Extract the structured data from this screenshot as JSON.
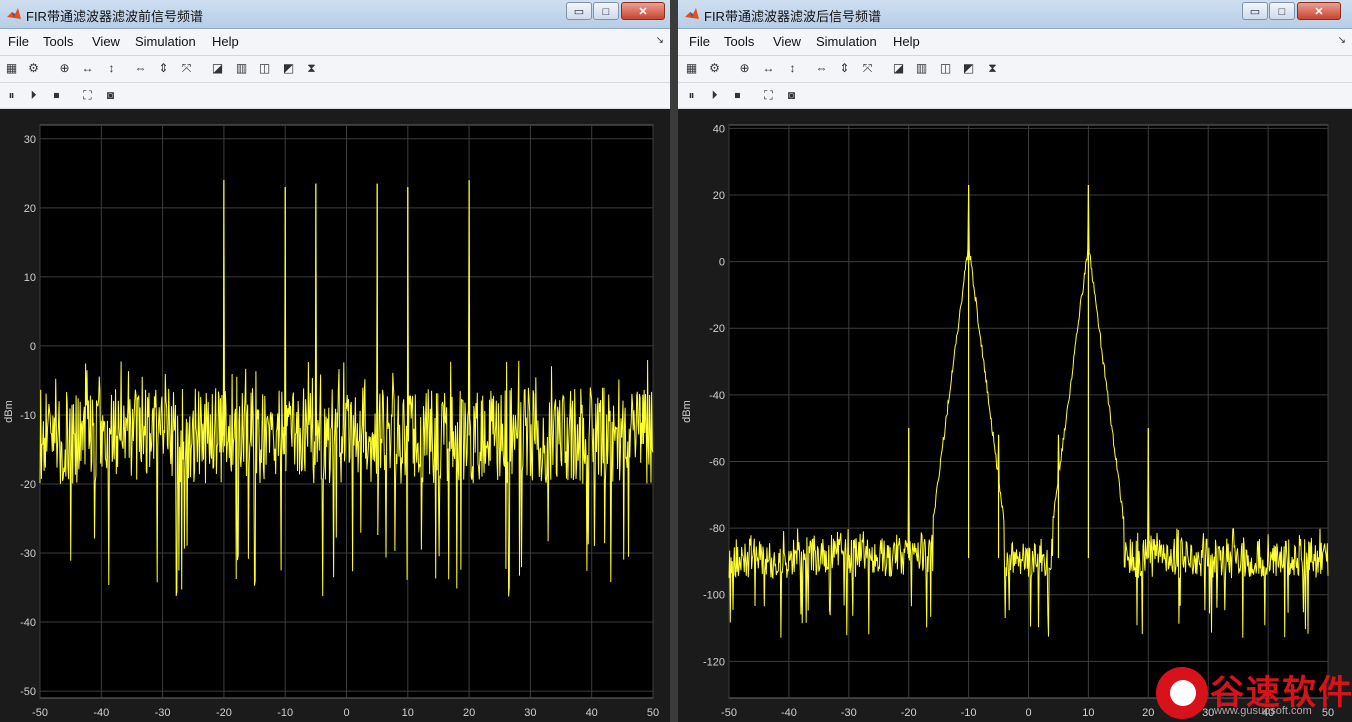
{
  "windows": [
    {
      "title": "FIR带通滤波器滤波前信号频谱",
      "menu": [
        "File",
        "Tools",
        "View",
        "Simulation",
        "Help"
      ],
      "window_buttons": {
        "minimize": "▭",
        "maximize": "□",
        "close": "✕"
      },
      "toolbar1_icons": [
        "new-scope-icon",
        "settings-gear-icon",
        "zoom-in-icon",
        "zoom-x-icon",
        "zoom-y-icon",
        "scale-x-icon",
        "scale-y-icon",
        "autoscale-icon",
        "triggers-icon",
        "peak-finder-icon",
        "cursor-measure-icon",
        "distortion-icon",
        "ccdf-icon"
      ],
      "toolbar2_icons": [
        "pause-icon",
        "step-forward-icon",
        "stop-icon",
        "highlight-block-icon",
        "snapshot-camera-icon"
      ]
    },
    {
      "title": "FIR带通滤波器滤波后信号频谱",
      "menu": [
        "File",
        "Tools",
        "View",
        "Simulation",
        "Help"
      ],
      "window_buttons": {
        "minimize": "▭",
        "maximize": "□",
        "close": "✕"
      },
      "toolbar1_icons": [
        "new-scope-icon",
        "settings-gear-icon",
        "zoom-in-icon",
        "zoom-x-icon",
        "zoom-y-icon",
        "scale-x-icon",
        "scale-y-icon",
        "autoscale-icon",
        "triggers-icon",
        "peak-finder-icon",
        "cursor-measure-icon",
        "distortion-icon",
        "ccdf-icon"
      ],
      "toolbar2_icons": [
        "pause-icon",
        "step-forward-icon",
        "stop-icon",
        "highlight-block-icon",
        "snapshot-camera-icon"
      ]
    }
  ],
  "colors": {
    "plot_bg": "#000000",
    "figure_bg": "#1b1b1b",
    "trace": "#ffff33",
    "grid": "#3c3c3c",
    "tick_text": "#d0d0d0"
  },
  "chart_data": [
    {
      "type": "line",
      "title": "",
      "xlabel": "",
      "ylabel": "dBm",
      "xlim": [
        -50,
        50
      ],
      "ylim": [
        -51,
        32
      ],
      "xticks": [
        -50,
        -40,
        -30,
        -20,
        -10,
        0,
        10,
        20,
        30,
        40,
        50
      ],
      "yticks": [
        -50,
        -40,
        -30,
        -20,
        -10,
        0,
        10,
        20,
        30
      ],
      "grid": true,
      "noise_floor": {
        "mean": -13,
        "spread": 7,
        "min": -37,
        "max": -2
      },
      "peaks": [
        {
          "x": -20,
          "y": 24
        },
        {
          "x": -10,
          "y": 23
        },
        {
          "x": -5,
          "y": 23.5
        },
        {
          "x": 5,
          "y": 23.5
        },
        {
          "x": 10,
          "y": 23
        },
        {
          "x": 20,
          "y": 24
        }
      ]
    },
    {
      "type": "line",
      "title": "",
      "xlabel": "",
      "ylabel": "dBm",
      "xlim": [
        -50,
        50
      ],
      "ylim": [
        -131,
        41
      ],
      "xticks": [
        -50,
        -40,
        -30,
        -20,
        -10,
        0,
        10,
        20,
        30,
        40,
        50
      ],
      "yticks": [
        -120,
        -100,
        -80,
        -60,
        -40,
        -20,
        0,
        20,
        40
      ],
      "grid": true,
      "noise_floor": {
        "mean": -89,
        "spread": 6,
        "min": -113,
        "max": -80
      },
      "peaks": [
        {
          "x": -20,
          "y": -50
        },
        {
          "x": -10,
          "y": 23
        },
        {
          "x": -5,
          "y": -52
        },
        {
          "x": 5,
          "y": -52
        },
        {
          "x": 10,
          "y": 23
        },
        {
          "x": 20,
          "y": -50
        }
      ]
    }
  ],
  "watermark": {
    "brand": "谷速软件",
    "url": "www.gusuosoft.com"
  }
}
